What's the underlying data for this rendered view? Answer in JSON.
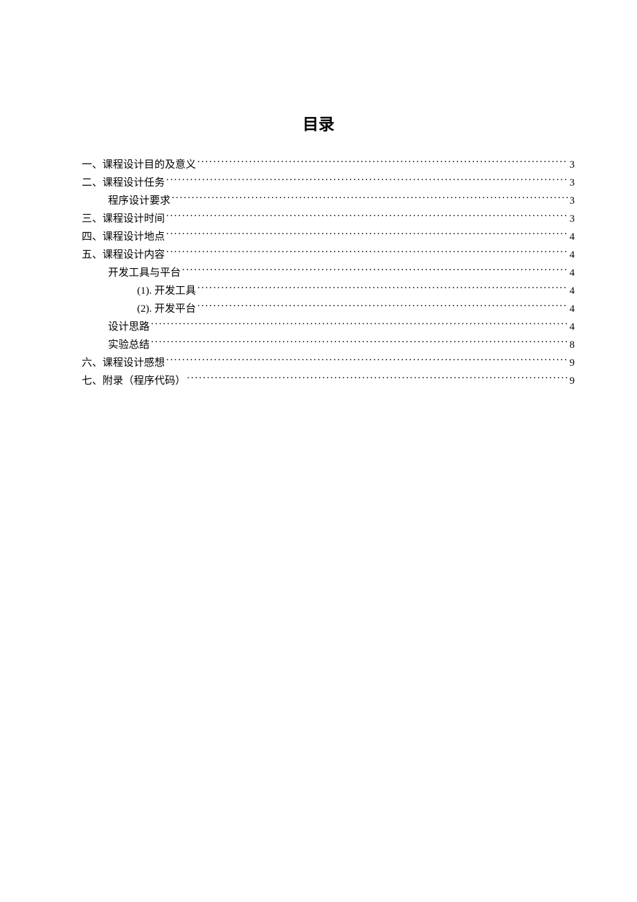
{
  "title": "目录",
  "toc": [
    {
      "label": "一、课程设计目的及意义",
      "page": "3",
      "indent": 0
    },
    {
      "label": "二、课程设计任务",
      "page": "3",
      "indent": 0
    },
    {
      "label": "程序设计要求",
      "page": "3",
      "indent": 1
    },
    {
      "label": "三、课程设计时间",
      "page": "3",
      "indent": 0
    },
    {
      "label": "四、课程设计地点",
      "page": "4",
      "indent": 0
    },
    {
      "label": "五、课程设计内容",
      "page": "4",
      "indent": 0
    },
    {
      "label": "开发工具与平台",
      "page": "4",
      "indent": 1
    },
    {
      "label": "(1). 开发工具",
      "page": "4",
      "indent": 2
    },
    {
      "label": "(2). 开发平台",
      "page": "4",
      "indent": 2
    },
    {
      "label": "设计思路",
      "page": "4",
      "indent": 1
    },
    {
      "label": "实验总结",
      "page": "8",
      "indent": 1
    },
    {
      "label": "六、课程设计感想",
      "page": "9",
      "indent": 0
    },
    {
      "label": "七、附录（程序代码）",
      "page": "9",
      "indent": 0
    }
  ]
}
